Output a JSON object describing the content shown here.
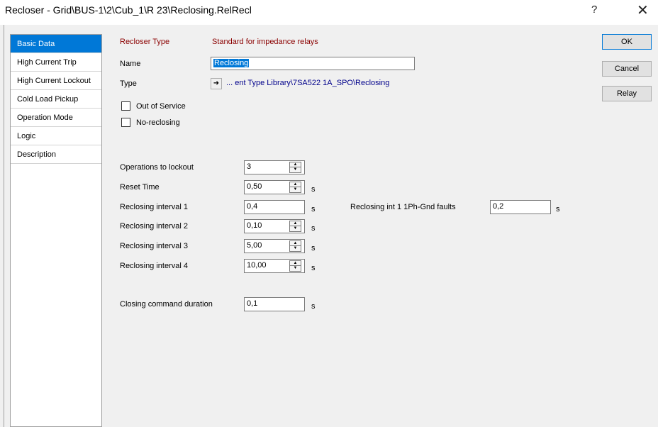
{
  "window": {
    "title": "Recloser - Grid\\BUS-1\\2\\Cub_1\\R 23\\Reclosing.RelRecl",
    "help_glyph": "?",
    "close_glyph": "✕"
  },
  "sidebar": {
    "items": [
      {
        "label": "Basic Data",
        "active": true
      },
      {
        "label": "High Current Trip"
      },
      {
        "label": "High Current Lockout"
      },
      {
        "label": "Cold Load Pickup"
      },
      {
        "label": "Operation Mode"
      },
      {
        "label": "Logic"
      },
      {
        "label": "Description"
      }
    ]
  },
  "header": {
    "recloser_type_label": "Recloser Type",
    "recloser_type_value": "Standard for impedance relays",
    "name_label": "Name",
    "name_value": "Reclosing",
    "type_label": "Type",
    "type_value": "... ent Type Library\\7SA522 1A_SPO\\Reclosing",
    "type_arrow_glyph": "➜",
    "out_of_service_label": "Out of Service",
    "no_reclosing_label": "No-reclosing",
    "out_of_service_checked": false,
    "no_reclosing_checked": false
  },
  "settings": {
    "operations_to_lockout": {
      "label": "Operations to lockout",
      "value": "3"
    },
    "reset_time": {
      "label": "Reset Time",
      "value": "0,50",
      "unit": "s"
    },
    "reclosing_interval_1": {
      "label": "Reclosing interval 1",
      "value": "0,4",
      "unit": "s"
    },
    "reclosing_int_1ph": {
      "label": "Reclosing int 1 1Ph-Gnd faults",
      "value": "0,2",
      "unit": "s"
    },
    "reclosing_interval_2": {
      "label": "Reclosing interval 2",
      "value": "0,10",
      "unit": "s"
    },
    "reclosing_interval_3": {
      "label": "Reclosing interval 3",
      "value": "5,00",
      "unit": "s"
    },
    "reclosing_interval_4": {
      "label": "Reclosing interval 4",
      "value": "10,00",
      "unit": "s"
    },
    "closing_command_duration": {
      "label": "Closing command duration",
      "value": "0,1",
      "unit": "s"
    }
  },
  "spinner": {
    "up_glyph": "▲",
    "down_glyph": "▼"
  },
  "buttons": {
    "ok": "OK",
    "cancel": "Cancel",
    "relay": "Relay"
  }
}
